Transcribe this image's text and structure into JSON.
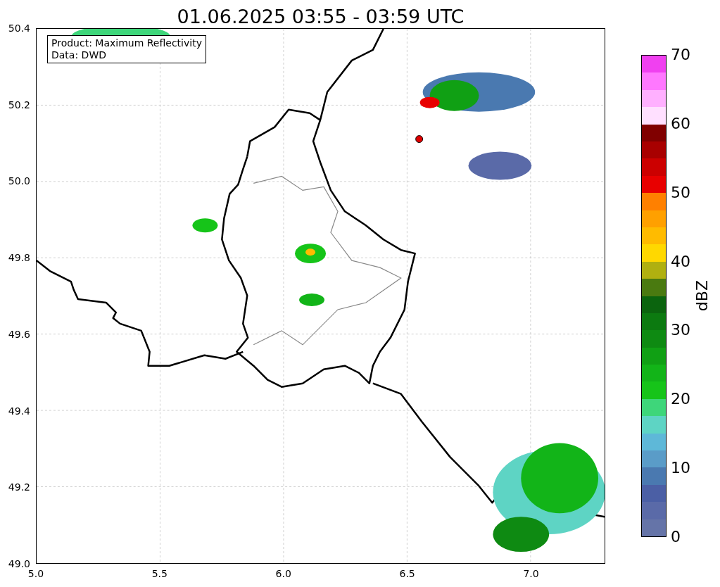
{
  "title": "01.06.2025 03:55 - 03:59 UTC",
  "legend_box": {
    "lines": [
      "Product: Maximum Reflectivity",
      "Data: DWD"
    ]
  },
  "y_ticks": [
    "50.4",
    "50.2",
    "50.0",
    "49.8",
    "49.6",
    "49.4",
    "49.2",
    "49.0"
  ],
  "x_ticks": [
    "5.0",
    "5.5",
    "6.0",
    "6.5",
    "7.0"
  ],
  "colorbar": {
    "label": "dBZ",
    "ticks": [
      "70",
      "60",
      "50",
      "40",
      "30",
      "20",
      "10",
      "0"
    ],
    "bins": [
      {
        "color": "#6574a8"
      },
      {
        "color": "#5a6aa8"
      },
      {
        "color": "#4b5fa5"
      },
      {
        "color": "#4a79b0"
      },
      {
        "color": "#5a9cc8"
      },
      {
        "color": "#5eb8d8"
      },
      {
        "color": "#5ed4c4"
      },
      {
        "color": "#3ed67a"
      },
      {
        "color": "#16c419"
      },
      {
        "color": "#12b418"
      },
      {
        "color": "#10a014"
      },
      {
        "color": "#0e8a12"
      },
      {
        "color": "#0c7a10"
      },
      {
        "color": "#0b640e"
      },
      {
        "color": "#4a7a10"
      },
      {
        "color": "#b0b010"
      },
      {
        "color": "#ffd800"
      },
      {
        "color": "#ffbb00"
      },
      {
        "color": "#ffa000"
      },
      {
        "color": "#ff8000"
      },
      {
        "color": "#e80000"
      },
      {
        "color": "#cc0000"
      },
      {
        "color": "#a80000"
      },
      {
        "color": "#800000"
      },
      {
        "color": "#ffe0ff"
      },
      {
        "color": "#ffb0ff"
      },
      {
        "color": "#ff78ff"
      },
      {
        "color": "#f040f0"
      }
    ]
  }
}
